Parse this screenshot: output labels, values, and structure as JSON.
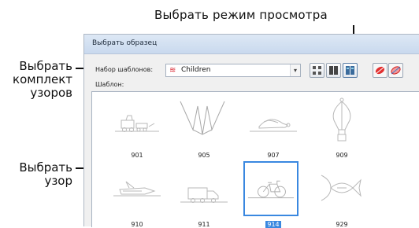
{
  "callouts": {
    "view_mode": "Выбрать режим просмотра",
    "select_set": "Выбрать\nкомплект\nузоров",
    "select_pattern": "Выбрать\nузор"
  },
  "dialog": {
    "title": "Выбрать образец",
    "set_label": "Набор шаблонов:",
    "set_value": "Children",
    "set_icon": "red-zigzag-icon",
    "pattern_label": "Шаблон:",
    "view_buttons": [
      "grid-view-icon",
      "columns-view-icon",
      "detail-view-icon"
    ],
    "stitch_buttons": [
      "stitch-fill-icon",
      "stitch-outline-icon"
    ]
  },
  "patterns": [
    {
      "id": "901",
      "icon": "train-car-icon",
      "selected": false
    },
    {
      "id": "905",
      "icon": "zigzag-lines-icon",
      "selected": false
    },
    {
      "id": "907",
      "icon": "turtle-icon",
      "selected": false
    },
    {
      "id": "909",
      "icon": "hot-air-balloon-icon",
      "selected": false
    },
    {
      "id": "910",
      "icon": "airplane-icon",
      "selected": false
    },
    {
      "id": "911",
      "icon": "truck-icon",
      "selected": false
    },
    {
      "id": "914",
      "icon": "bicycle-icon",
      "selected": true
    },
    {
      "id": "929",
      "icon": "fish-icon",
      "selected": false
    }
  ]
}
